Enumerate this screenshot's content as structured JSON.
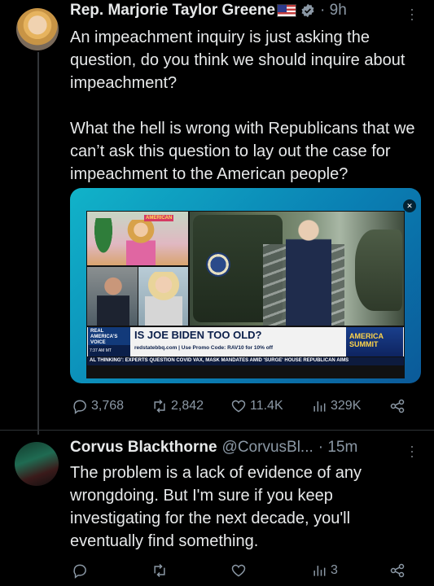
{
  "tweet": {
    "author_name": "Rep. Marjorie Taylor Greene",
    "time": "9h",
    "paragraph1": "An impeachment inquiry is just asking the question, do you think we should inquire about impeachment?",
    "paragraph2": "What the hell is wrong with Republicans that we can’t ask this question to lay out the case for impeachment to the American people?",
    "media": {
      "network_tag": "AMERICAN",
      "logo_text": "REAL AMERICA'S VOICE",
      "headline": "IS JOE BIDEN TOO OLD?",
      "time_box": "7:37 AM MT",
      "subline": "redstatebbq.com | Use Promo Code: RAV10 for 10% off",
      "brand2": "AMERICA SUMMIT",
      "ticker": "AL THINKING': EXPERTS QUESTION COVID VAX, MASK MANDATES AMID 'SURGE'     HOUSE REPUBLICAN AIMS"
    },
    "stats": {
      "replies": "3,768",
      "retweets": "2,842",
      "likes": "11.4K",
      "views": "329K"
    }
  },
  "reply": {
    "author_name": "Corvus Blackthorne",
    "handle": "@CorvusBl...",
    "time": "15m",
    "text": "The problem is a lack of evidence of any wrongdoing. But I'm sure if you keep investigating for the next decade, you'll eventually find something.",
    "stats": {
      "views": "3"
    }
  },
  "colors": {
    "background": "#000000",
    "text": "#e7e9ea",
    "muted": "#8b98a5",
    "verified": "#8b98a5"
  }
}
